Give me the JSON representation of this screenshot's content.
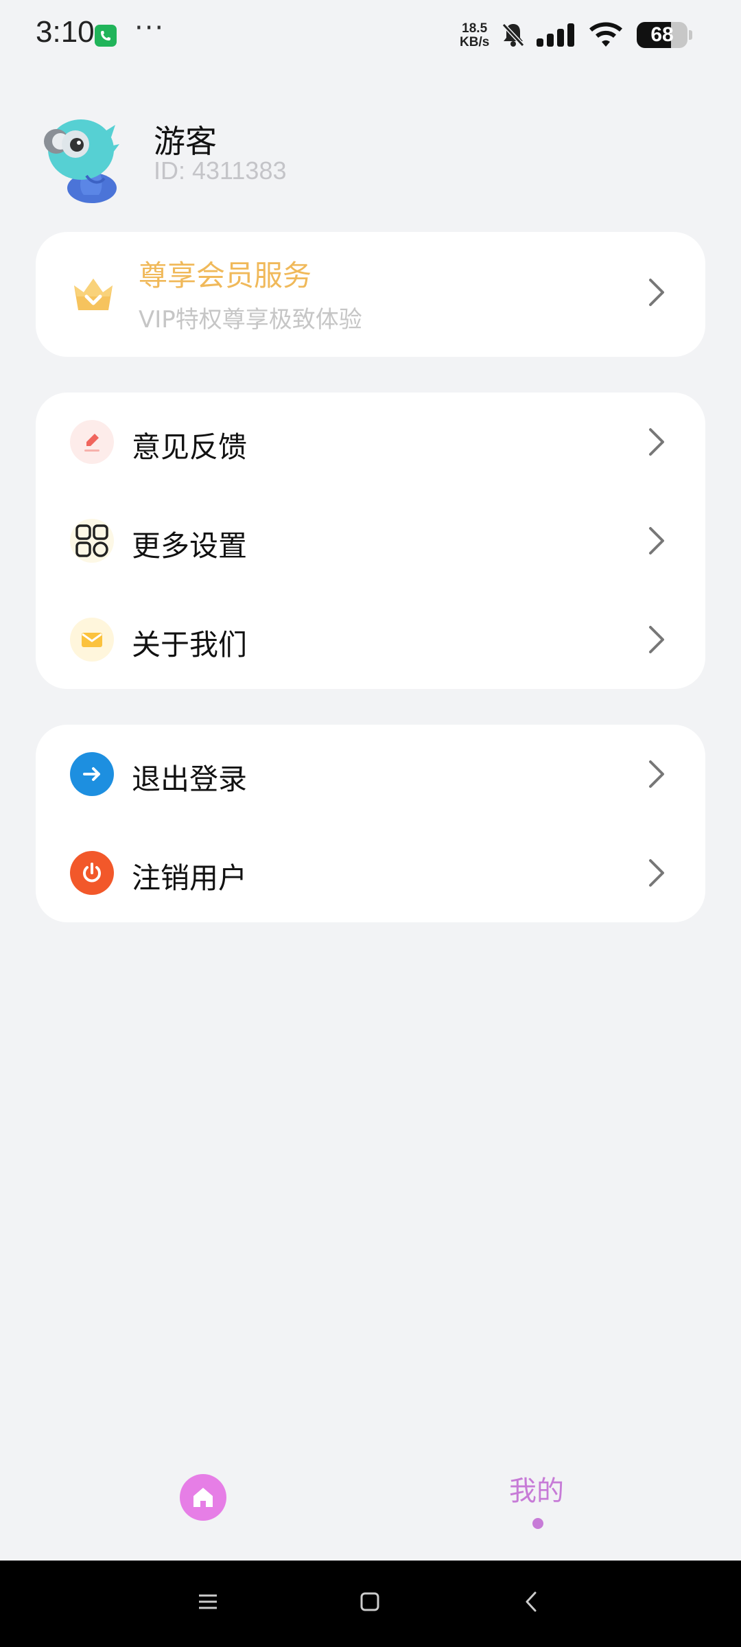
{
  "status_bar": {
    "time": "3:10",
    "more": "···",
    "net_speed_value": "18.5",
    "net_speed_unit": "KB/s",
    "battery_level": "68",
    "battery_fraction": 0.68
  },
  "profile": {
    "name": "游客",
    "id_text": "ID: 4311383"
  },
  "vip": {
    "title": "尊享会员服务",
    "subtitle": "VIP特权尊享极致体验",
    "accent_color": "#f0b95a"
  },
  "menu_group_1": [
    {
      "label": "意见反馈",
      "icon": "feedback-pen-icon"
    },
    {
      "label": "更多设置",
      "icon": "grid-settings-icon"
    },
    {
      "label": "关于我们",
      "icon": "mail-icon"
    }
  ],
  "menu_group_2": [
    {
      "label": "退出登录",
      "icon": "logout-arrow-icon"
    },
    {
      "label": "注销用户",
      "icon": "power-icon"
    }
  ],
  "bottom_nav": {
    "home_icon": "home-icon",
    "mine_label": "我的",
    "active_color": "#c77bd7"
  },
  "system_nav": {
    "menu_icon": "menu-icon",
    "home_icon": "square-home-icon",
    "back_icon": "back-icon"
  }
}
